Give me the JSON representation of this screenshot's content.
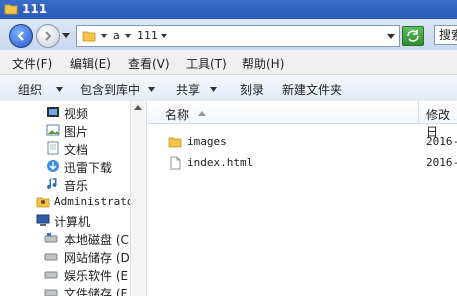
{
  "window": {
    "title": "111"
  },
  "address": {
    "crumbs": [
      "a",
      "111"
    ],
    "search_placeholder": "搜索"
  },
  "menu": {
    "items": [
      "文件(F)",
      "编辑(E)",
      "查看(V)",
      "工具(T)",
      "帮助(H)"
    ]
  },
  "toolbar": {
    "organize": "组织",
    "include_in_library": "包含到库中",
    "share": "共享",
    "burn": "刻录",
    "new_folder": "新建文件夹"
  },
  "nav": {
    "items": [
      {
        "label": "视频",
        "icon": "video-library-icon"
      },
      {
        "label": "图片",
        "icon": "picture-library-icon"
      },
      {
        "label": "文档",
        "icon": "document-library-icon"
      },
      {
        "label": "迅雷下载",
        "icon": "thunder-download-icon"
      },
      {
        "label": "音乐",
        "icon": "music-library-icon"
      },
      {
        "label": "Administrator",
        "icon": "user-folder-icon"
      },
      {
        "label": "计算机",
        "icon": "computer-icon"
      },
      {
        "label": "本地磁盘 (C",
        "icon": "local-disk-icon"
      },
      {
        "label": "网站储存 (D",
        "icon": "drive-icon"
      },
      {
        "label": "娱乐软件 (E",
        "icon": "drive-icon"
      },
      {
        "label": "文件储存 (F",
        "icon": "drive-icon"
      }
    ]
  },
  "list": {
    "columns": {
      "name": "名称",
      "modified": "修改日"
    },
    "files": [
      {
        "name": "images",
        "modified": "2016-",
        "icon": "folder-icon"
      },
      {
        "name": "index.html",
        "modified": "2016-",
        "icon": "html-file-icon"
      }
    ]
  },
  "colors": {
    "titlebar": "#2b5bb8",
    "toolbar": "#e3ebf6",
    "folder": "#f3c44a",
    "refresh": "#2e8b2e"
  }
}
